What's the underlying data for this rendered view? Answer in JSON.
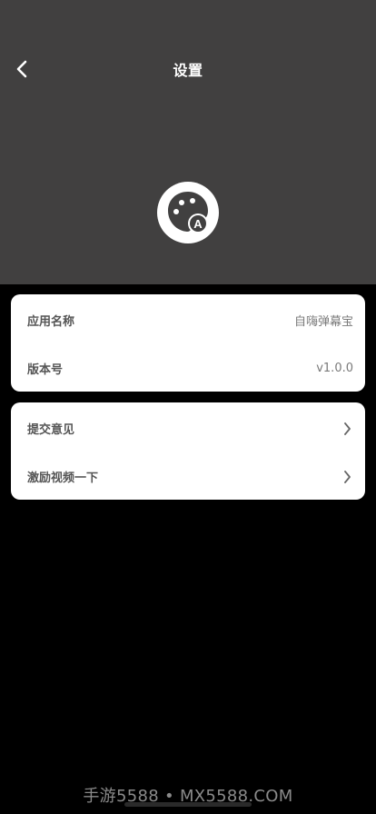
{
  "header": {
    "title": "设置"
  },
  "app_info": {
    "name_label": "应用名称",
    "name_value": "自嗨弹幕宝",
    "version_label": "版本号",
    "version_value": "v1.0.0"
  },
  "actions": {
    "feedback_label": "提交意见",
    "video_label": "激励视频一下"
  },
  "watermark": "手游5588 • MX5588.COM",
  "colors": {
    "header_bg": "#414040",
    "page_bg": "#000000",
    "card_bg": "#ffffff",
    "label": "#555555",
    "value": "#7a7a7a"
  }
}
